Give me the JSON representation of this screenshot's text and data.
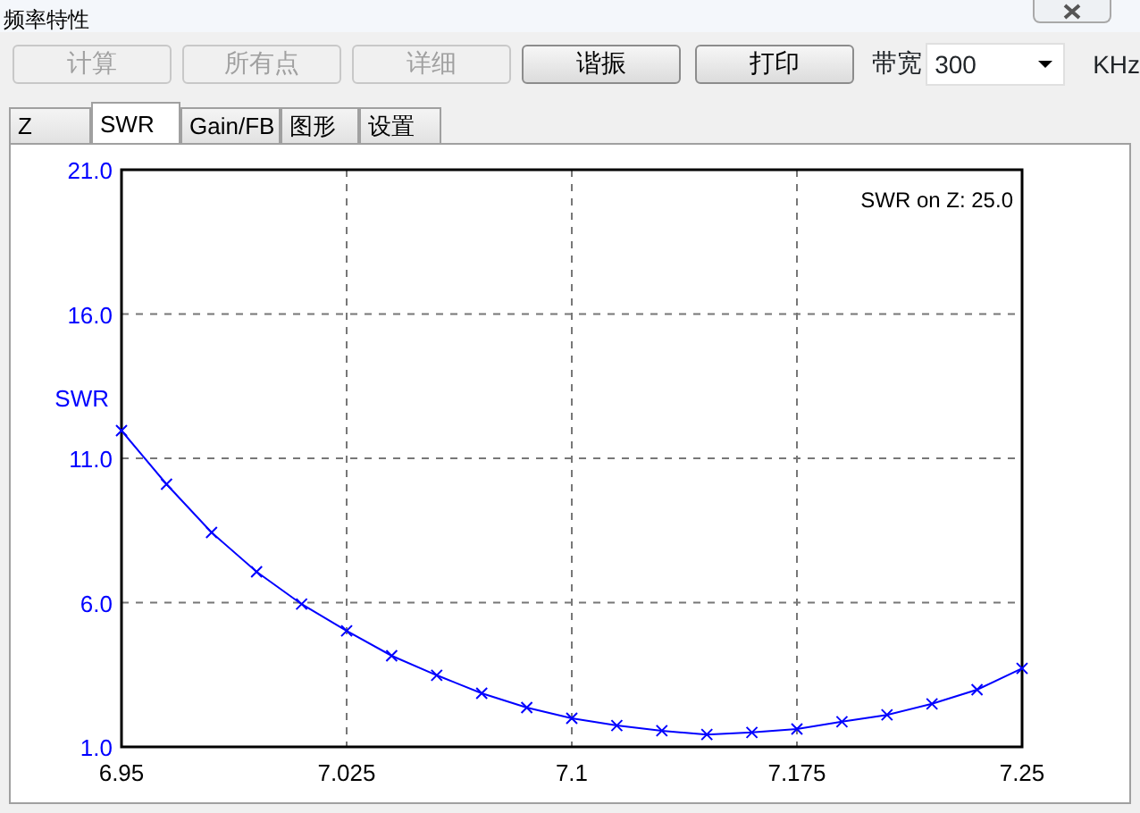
{
  "window": {
    "title": "频率特性"
  },
  "buttons": [
    {
      "label": "计算",
      "disabled": true
    },
    {
      "label": "所有点",
      "disabled": true
    },
    {
      "label": "详细",
      "disabled": true
    },
    {
      "label": "谐振",
      "disabled": false
    },
    {
      "label": "打印",
      "disabled": false
    }
  ],
  "bandwidth": {
    "label": "带宽",
    "value": "300",
    "unit": "KHz"
  },
  "tabs": [
    {
      "label": "Z",
      "selected": false
    },
    {
      "label": "SWR",
      "selected": true
    },
    {
      "label": "Gain/FB",
      "selected": false
    },
    {
      "label": "图形",
      "selected": false
    },
    {
      "label": "设置",
      "selected": false
    }
  ],
  "chart_data": {
    "type": "line",
    "ylabel": "SWR",
    "annotations": [
      "SWR on Z: 25.0"
    ],
    "x": [
      6.95,
      6.965,
      6.98,
      6.995,
      7.01,
      7.025,
      7.04,
      7.055,
      7.07,
      7.085,
      7.1,
      7.115,
      7.13,
      7.145,
      7.16,
      7.175,
      7.19,
      7.205,
      7.22,
      7.235,
      7.25
    ],
    "grid": true,
    "series": [
      {
        "marker": "x",
        "color": "#0000ff",
        "values": [
          11.96,
          10.1,
          8.43,
          7.07,
          5.95,
          5.02,
          4.16,
          3.48,
          2.86,
          2.36,
          1.99,
          1.74,
          1.56,
          1.43,
          1.5,
          1.62,
          1.87,
          2.11,
          2.49,
          2.98,
          3.72
        ]
      }
    ],
    "xlim": [
      6.95,
      7.25
    ],
    "ylim": [
      1,
      21
    ],
    "xticks": [
      6.95,
      7.025,
      7.1,
      7.175,
      7.25
    ],
    "yticks": [
      {
        "value": 1,
        "label": "1.0"
      },
      {
        "value": 6,
        "label": "6.0"
      },
      {
        "value": 11,
        "label": "11.0"
      },
      {
        "value": 16,
        "label": "16.0"
      },
      {
        "value": 21,
        "label": "21.0"
      }
    ]
  }
}
